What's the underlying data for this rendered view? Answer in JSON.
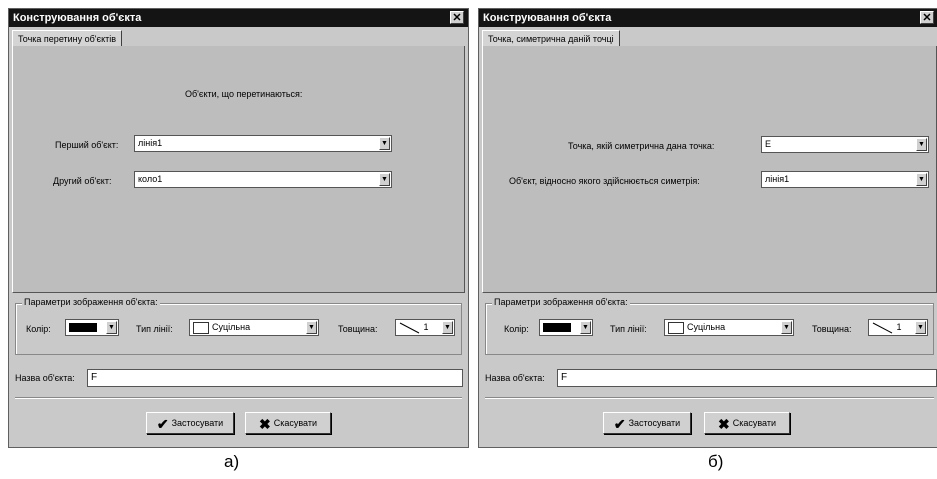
{
  "dialog_a": {
    "title": "Конструювання об'єкта",
    "close": "✕",
    "tab": "Точка перетину об'єктів",
    "heading": "Об'єкти, що перетинаються:",
    "first_label": "Перший об'єкт:",
    "first_value": "лінія1",
    "second_label": "Другий об'єкт:",
    "second_value": "коло1",
    "group_title": "Параметри зображення об'єкта:",
    "color_label": "Колір:",
    "line_type_label": "Тип лінії:",
    "line_type_value": "Суцільна",
    "thickness_label": "Товщина:",
    "thickness_value": "1",
    "name_label": "Назва об'єкта:",
    "name_value": "F",
    "apply_button": "Застосувати",
    "cancel_button": "Скасувати"
  },
  "dialog_b": {
    "title": "Конструювання об'єкта",
    "close": "✕",
    "tab": "Точка, симетрична даній точці",
    "point_label": "Точка, якій симетрична дана точка:",
    "point_value": "E",
    "object_label": "Об'єкт, відносно якого здійснюється симетрія:",
    "object_value": "лінія1",
    "group_title": "Параметри зображення об'єкта:",
    "color_label": "Колір:",
    "line_type_label": "Тип лінії:",
    "line_type_value": "Суцільна",
    "thickness_label": "Товщина:",
    "thickness_value": "1",
    "name_label": "Назва об'єкта:",
    "name_value": "F",
    "apply_button": "Застосувати",
    "cancel_button": "Скасувати"
  },
  "captions": {
    "a": "а)",
    "b": "б)"
  },
  "icons": {
    "dropdown": "▼",
    "apply": "✔",
    "cancel": "✖"
  }
}
